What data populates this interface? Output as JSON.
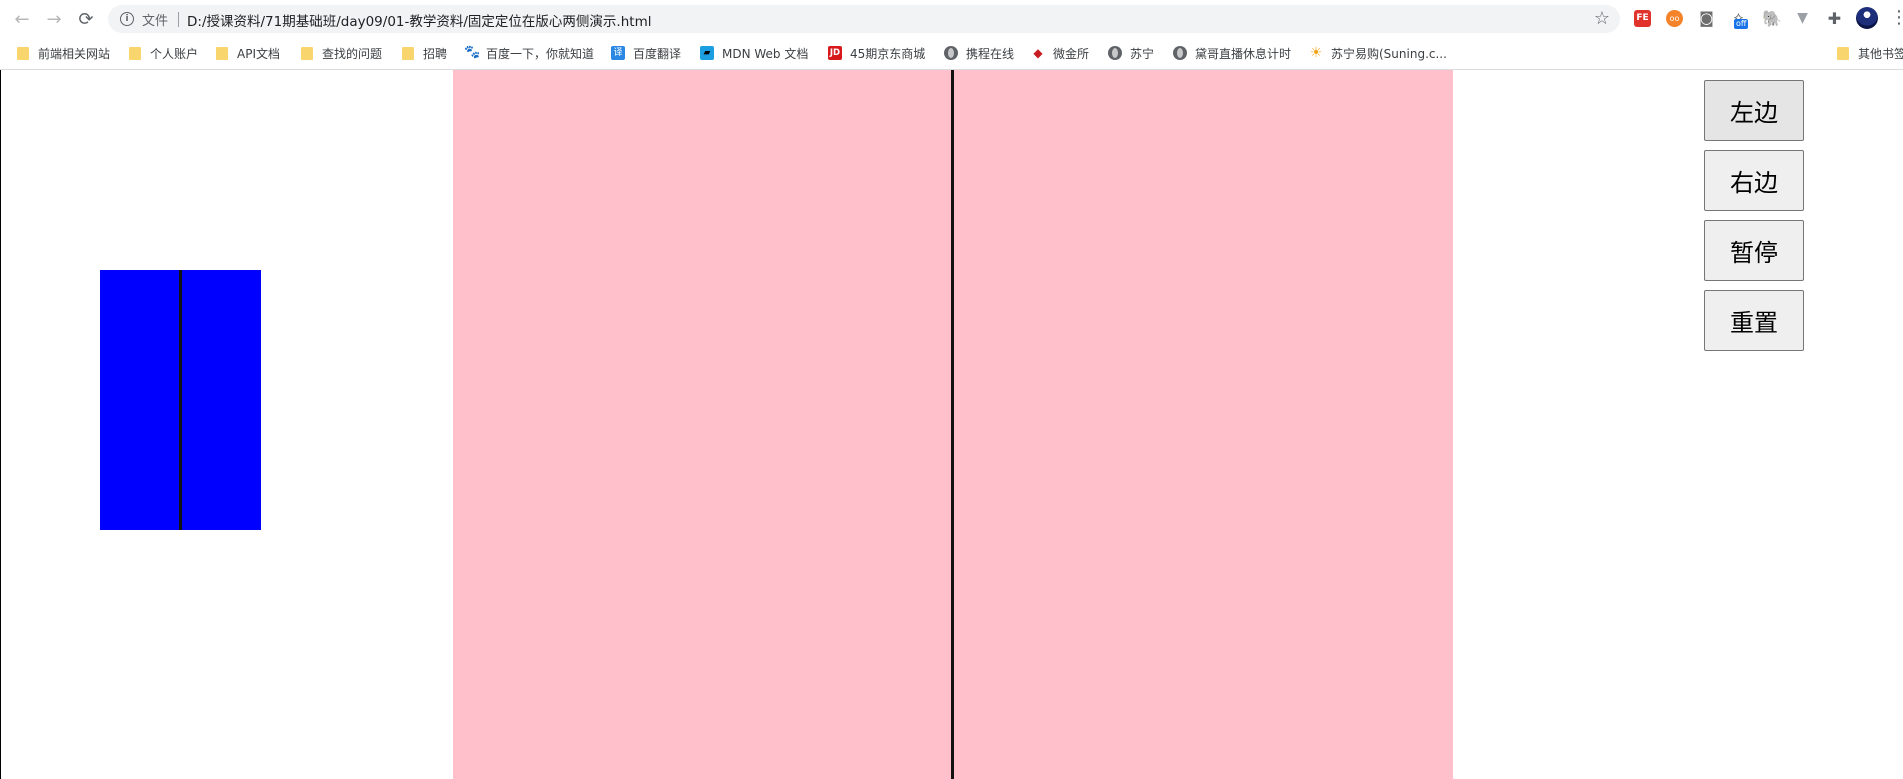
{
  "browser": {
    "url_scheme_label": "文件",
    "url": "D:/授课资料/71期基础班/day09/01-教学资料/固定定位在版心两侧演示.html",
    "extensions": [
      "fe-icon",
      "oo-icon",
      "camera-icon",
      "off-icon",
      "evernote-icon",
      "v-icon",
      "puzzle-icon"
    ],
    "ext_labels": {
      "fe": "FE",
      "oo": "oo",
      "off_badge": "off"
    }
  },
  "bookmarks": [
    {
      "label": "前端相关网站",
      "icon": "folder-icon"
    },
    {
      "label": "个人账户",
      "icon": "folder-icon"
    },
    {
      "label": "API文档",
      "icon": "folder-icon"
    },
    {
      "label": "查找的问题",
      "icon": "folder-icon"
    },
    {
      "label": "招聘",
      "icon": "folder-icon"
    },
    {
      "label": "百度一下，你就知道",
      "icon": "baidu-paw-icon"
    },
    {
      "label": "百度翻译",
      "icon": "baidu-translate-icon"
    },
    {
      "label": "MDN Web 文档",
      "icon": "mdn-icon"
    },
    {
      "label": "45期京东商城",
      "icon": "jd-icon"
    },
    {
      "label": "携程在线",
      "icon": "globe-icon"
    },
    {
      "label": "微金所",
      "icon": "weijinsuo-icon"
    },
    {
      "label": "苏宁",
      "icon": "globe-icon"
    },
    {
      "label": "黛哥直播休息计时",
      "icon": "globe-icon"
    },
    {
      "label": "苏宁易购(Suning.c...",
      "icon": "suning-icon"
    }
  ],
  "other_bookmarks": "其他书签",
  "icon_glyphs": {
    "fe": "FE",
    "jd": "JD",
    "translate": "译",
    "paw": "🐾"
  },
  "buttons": {
    "left": "左边",
    "right": "右边",
    "pause": "暂停",
    "reset": "重置"
  },
  "colors": {
    "version_area": "#ffc0cb",
    "side_box": "#0000ff",
    "center_line": "#111111"
  }
}
